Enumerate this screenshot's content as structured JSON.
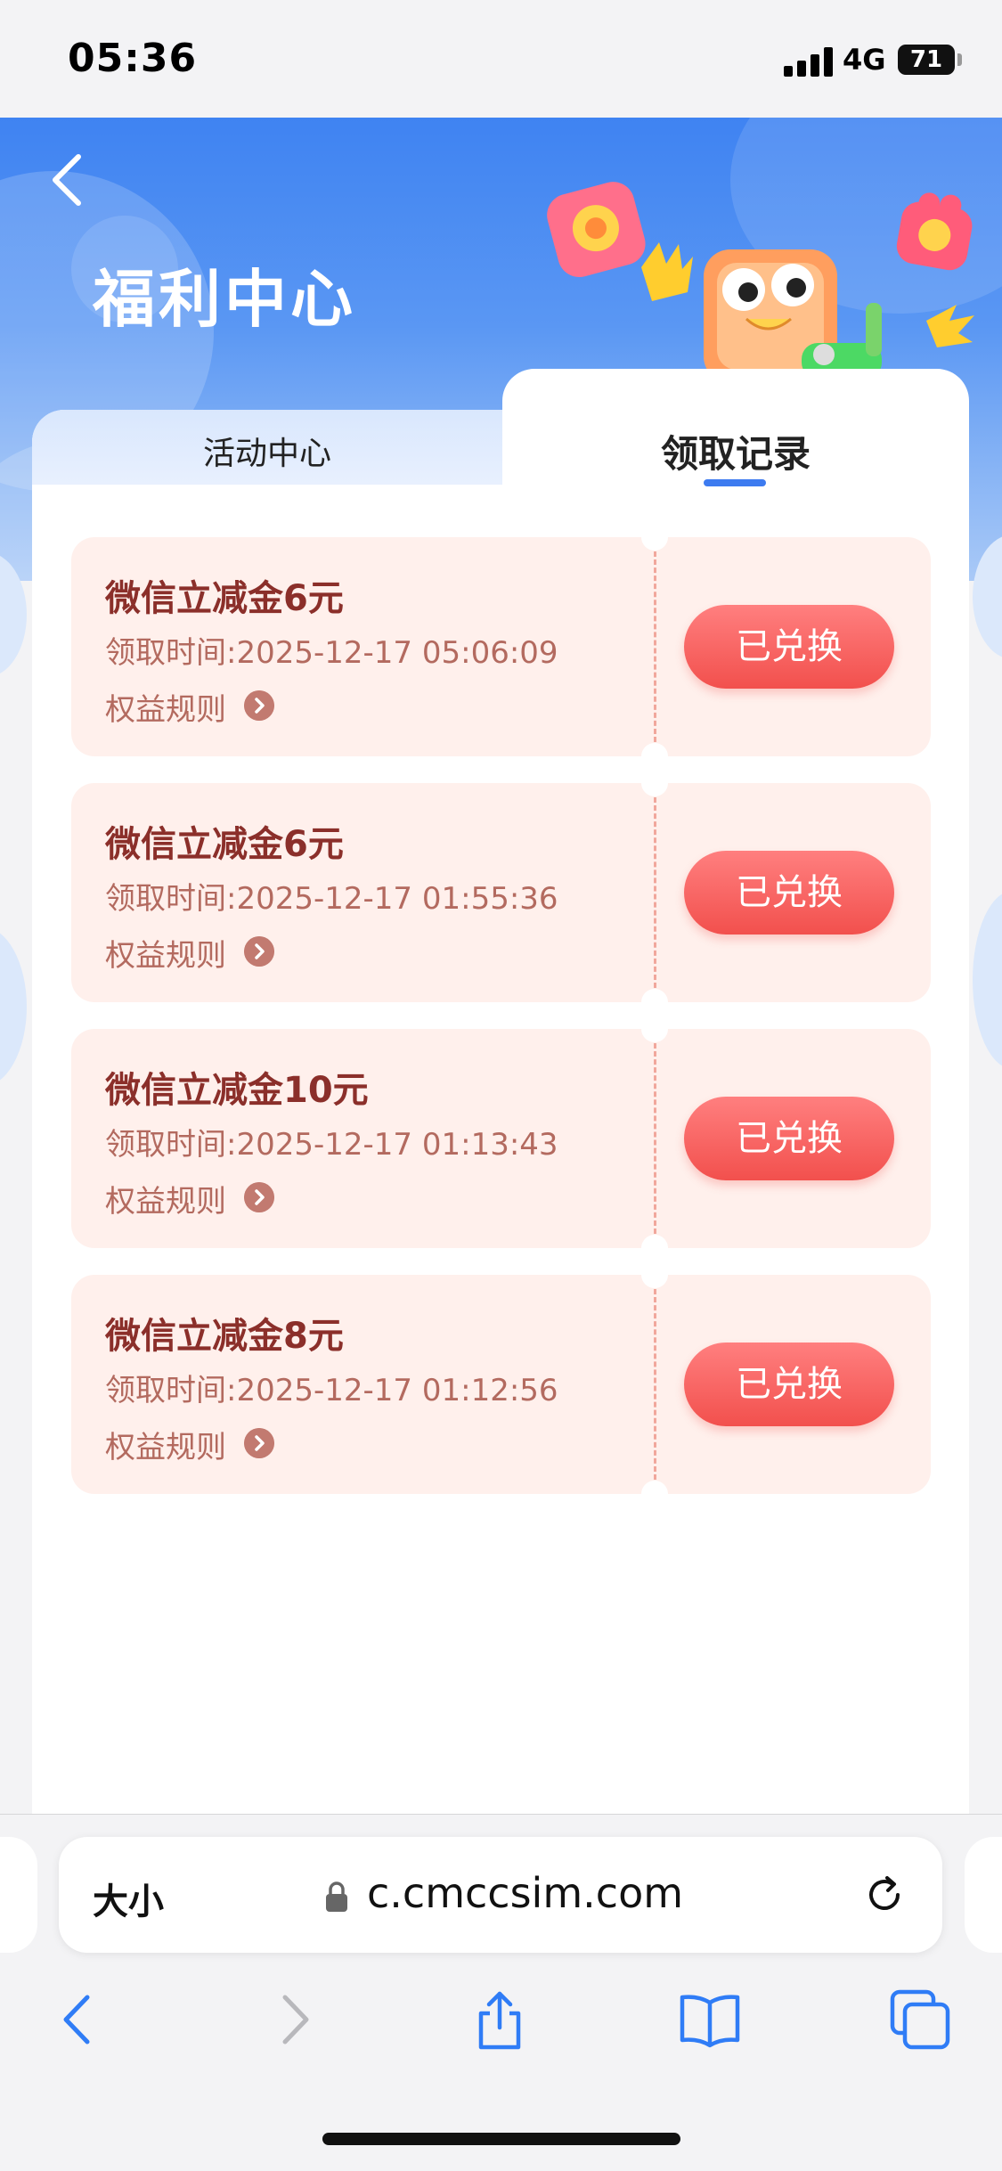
{
  "status_bar": {
    "time": "05:36",
    "network": "4G",
    "battery": "71"
  },
  "header": {
    "title": "福利中心"
  },
  "tabs": [
    {
      "label": "活动中心",
      "active": false
    },
    {
      "label": "领取记录",
      "active": true
    }
  ],
  "rule_label": "权益规则",
  "coupons": [
    {
      "title": "微信立减金6元",
      "claim_time": "领取时间:2025-12-17 05:06:09",
      "status": "已兑换"
    },
    {
      "title": "微信立减金6元",
      "claim_time": "领取时间:2025-12-17 01:55:36",
      "status": "已兑换"
    },
    {
      "title": "微信立减金10元",
      "claim_time": "领取时间:2025-12-17 01:13:43",
      "status": "已兑换"
    },
    {
      "title": "微信立减金8元",
      "claim_time": "领取时间:2025-12-17 01:12:56",
      "status": "已兑换"
    }
  ],
  "browser": {
    "text_size_label": "大小",
    "url": "c.cmccsim.com",
    "toolbar_icons": [
      "back-icon",
      "forward-icon",
      "share-icon",
      "bookmarks-icon",
      "tabs-icon"
    ]
  },
  "colors": {
    "accent": "#3d7bf0",
    "button": "#f2504d",
    "card_bg": "#fff0ec"
  }
}
